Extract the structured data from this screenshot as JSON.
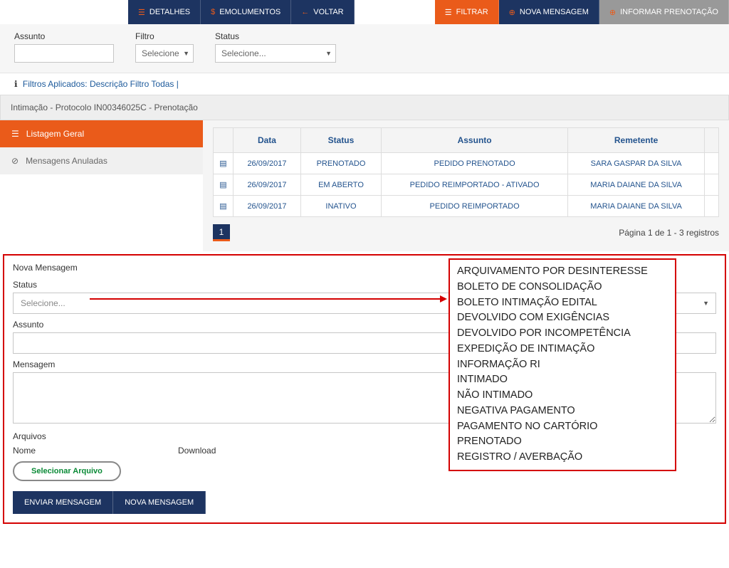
{
  "toolbar": {
    "detalhes": "DETALHES",
    "emolumentos": "EMOLUMENTOS",
    "voltar": "VOLTAR",
    "filtrar": "FILTRAR",
    "nova_mensagem": "NOVA MENSAGEM",
    "informar_prenotacao": "INFORMAR PRENOTAÇÃO"
  },
  "filters": {
    "assunto_label": "Assunto",
    "filtro_label": "Filtro",
    "filtro_value": "Selecione...",
    "status_label": "Status",
    "status_value": "Selecione..."
  },
  "applied_filters_text": "Filtros Aplicados: Descrição Filtro Todas |",
  "page_title": "Intimação - Protocolo IN00346025C - Prenotação",
  "sidebar": {
    "listagem_geral": "Listagem Geral",
    "mensagens_anuladas": "Mensagens Anuladas"
  },
  "table": {
    "headers": {
      "data": "Data",
      "status": "Status",
      "assunto": "Assunto",
      "remetente": "Remetente"
    },
    "rows": [
      {
        "data": "26/09/2017",
        "status": "PRENOTADO",
        "assunto": "PEDIDO PRENOTADO",
        "remetente": "SARA GASPAR DA SILVA"
      },
      {
        "data": "26/09/2017",
        "status": "EM ABERTO",
        "assunto": "PEDIDO REIMPORTADO - ATIVADO",
        "remetente": "MARIA DAIANE DA SILVA"
      },
      {
        "data": "26/09/2017",
        "status": "INATIVO",
        "assunto": "PEDIDO REIMPORTADO",
        "remetente": "MARIA DAIANE DA SILVA"
      }
    ],
    "page_current": "1",
    "page_info": "Página 1 de 1 - 3 registros"
  },
  "nova_msg": {
    "title": "Nova Mensagem",
    "status_label": "Status",
    "status_value": "Selecione...",
    "assunto_label": "Assunto",
    "mensagem_label": "Mensagem",
    "arquivos_label": "Arquivos",
    "nome_label": "Nome",
    "download_label": "Download",
    "selecionar_arquivo": "Selecionar Arquivo",
    "enviar": "ENVIAR MENSAGEM",
    "nova": "NOVA MENSAGEM",
    "options": [
      "ARQUIVAMENTO POR DESINTERESSE",
      "BOLETO DE CONSOLIDAÇÃO",
      "BOLETO INTIMAÇÃO EDITAL",
      "DEVOLVIDO COM EXIGÊNCIAS",
      "DEVOLVIDO POR INCOMPETÊNCIA",
      "EXPEDIÇÃO DE INTIMAÇÃO",
      "INFORMAÇÃO RI",
      "INTIMADO",
      "NÃO INTIMADO",
      "NEGATIVA PAGAMENTO",
      "PAGAMENTO NO CARTÓRIO",
      "PRENOTADO",
      "REGISTRO / AVERBAÇÃO"
    ]
  }
}
